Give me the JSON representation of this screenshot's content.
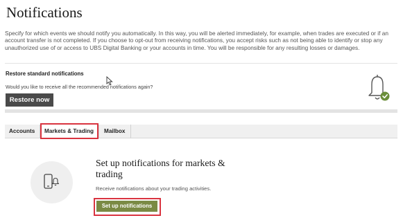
{
  "header": {
    "title": "Notifications",
    "intro": "Specify for which events we should notify you automatically. In this way, you will be alerted immediately, for example, when trades are executed or if an account transfer is not completed. If you choose to opt-out from receiving notifications, you accept risks such as not being able to identify or stop any unauthorized use of or access to UBS Digital Banking or your accounts in time. You will be responsible for any resulting losses or damages."
  },
  "restore": {
    "title": "Restore standard notifications",
    "question": "Would you like to receive all the recommended notifications again?",
    "button_label": "Restore now",
    "icon": "bell-with-check-icon"
  },
  "tabs": [
    {
      "label": "Accounts",
      "active": false
    },
    {
      "label": "Markets & Trading",
      "active": true
    },
    {
      "label": "Mailbox",
      "active": false
    }
  ],
  "setup": {
    "icon": "phone-notification-icon",
    "title": "Set up notifications for markets & trading",
    "description": "Receive notifications about your trading activities.",
    "button_label": "Set up notifications"
  },
  "colors": {
    "highlight": "#d9333f",
    "primary_button": "#7a8a44",
    "secondary_button": "#4a4a4a",
    "check_badge": "#6b8e3a"
  }
}
